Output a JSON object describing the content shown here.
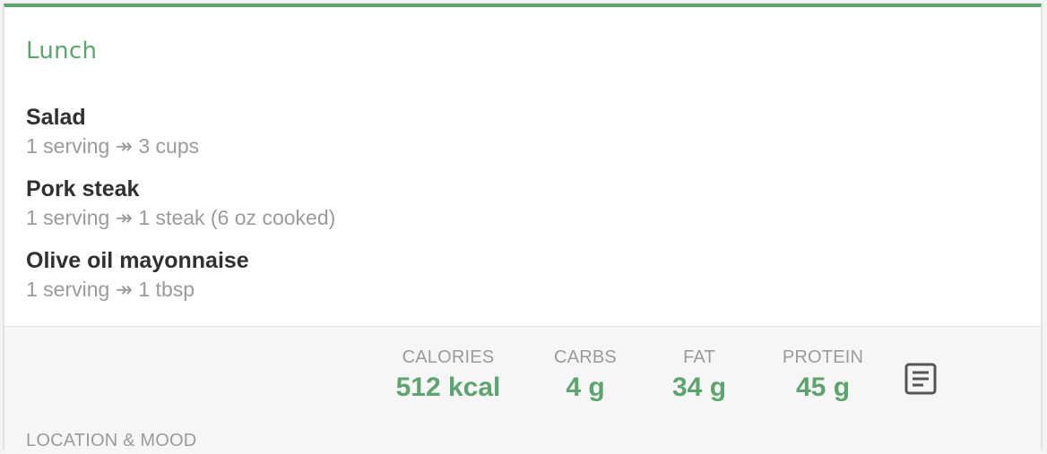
{
  "meal": {
    "title": "Lunch",
    "accent_color": "#5da46e",
    "foods": [
      {
        "name": "Salad",
        "serving": "1 serving ↠ 3 cups"
      },
      {
        "name": "Pork steak",
        "serving": "1 serving ↠ 1 steak (6 oz cooked)"
      },
      {
        "name": "Olive oil mayonnaise",
        "serving": "1 serving ↠ 1 tbsp"
      }
    ]
  },
  "nutrition": {
    "calories": {
      "label": "CALORIES",
      "value": "512 kcal"
    },
    "carbs": {
      "label": "CARBS",
      "value": "4 g"
    },
    "fat": {
      "label": "FAT",
      "value": "34 g"
    },
    "protein": {
      "label": "PROTEIN",
      "value": "45 g"
    },
    "details_icon": "notes-icon"
  },
  "section": {
    "location_mood_label": "LOCATION & MOOD"
  }
}
